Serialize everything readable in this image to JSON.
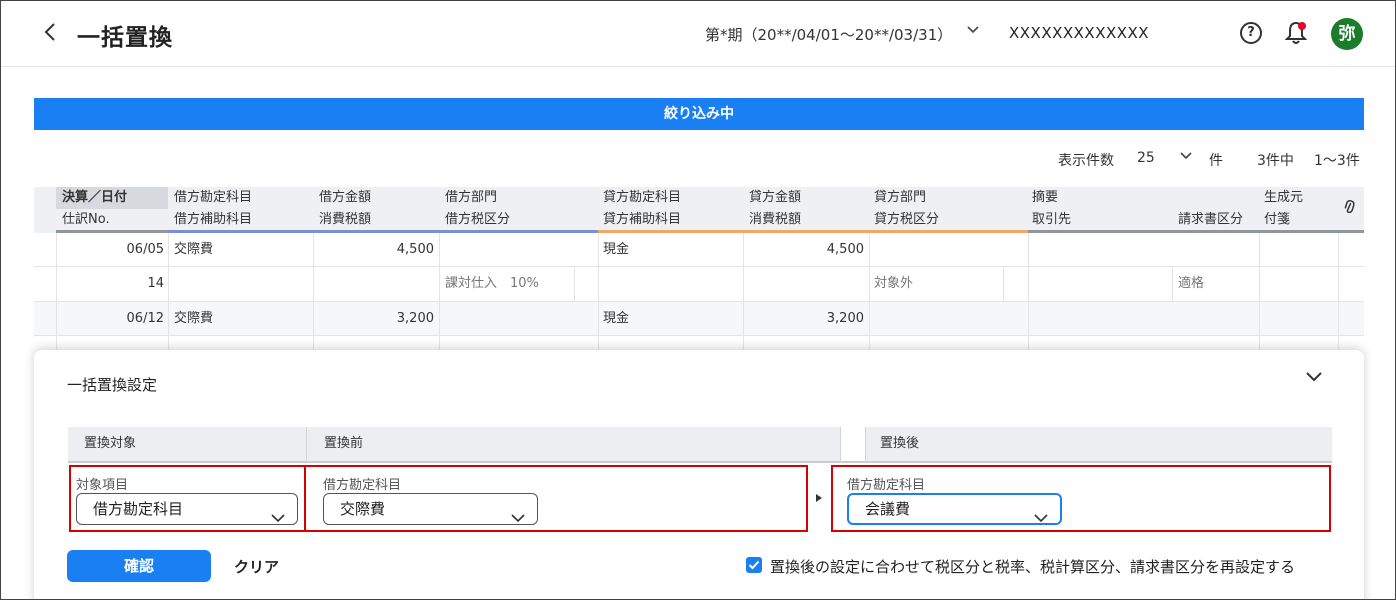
{
  "header": {
    "title": "一括置換",
    "period": "第*期（20**/04/01〜20**/03/31）",
    "company": "XXXXXXXXXXXXX",
    "avatar": "弥"
  },
  "filter_banner": "絞り込み中",
  "pagination": {
    "per_page_label": "表示件数",
    "per_page_value": "25",
    "unit": "件",
    "total": "3件中",
    "range": "1〜3件"
  },
  "table": {
    "headers_top": [
      "決算／日付",
      "借方勘定科目",
      "借方金額",
      "借方部門",
      "貸方勘定科目",
      "貸方金額",
      "貸方部門",
      "摘要",
      "生成元"
    ],
    "headers_bottom": [
      "仕訳No.",
      "借方補助科目",
      "消費税額",
      "借方税区分",
      "貸方補助科目",
      "消費税額",
      "貸方税区分",
      "取引先",
      "請求書区分",
      "付箋"
    ],
    "rows": [
      {
        "date": "06/05",
        "debit_account": "交際費",
        "debit_amount": "4,500",
        "credit_account": "現金",
        "credit_amount": "4,500",
        "no": "14",
        "debit_tax": "課対仕入　10%",
        "credit_tax": "対象外",
        "invoice": "適格"
      },
      {
        "date": "06/12",
        "debit_account": "交際費",
        "debit_amount": "3,200",
        "credit_account": "現金",
        "credit_amount": "3,200"
      }
    ]
  },
  "panel": {
    "title": "一括置換設定",
    "col_target": "置換対象",
    "col_before": "置換前",
    "col_after": "置換後",
    "target_label": "対象項目",
    "target_value": "借方勘定科目",
    "before_label": "借方勘定科目",
    "before_value": "交際費",
    "after_label": "借方勘定科目",
    "after_value": "会議費",
    "confirm": "確認",
    "clear": "クリア",
    "reset_option": "置換後の設定に合わせて税区分と税率、税計算区分、請求書区分を再設定する"
  },
  "colors": {
    "accent": "#1a7ff2",
    "highlight": "#d60000",
    "avatar": "#1b7d2c",
    "debit_line": "#7b8fd6",
    "credit_line": "#f0a864"
  }
}
